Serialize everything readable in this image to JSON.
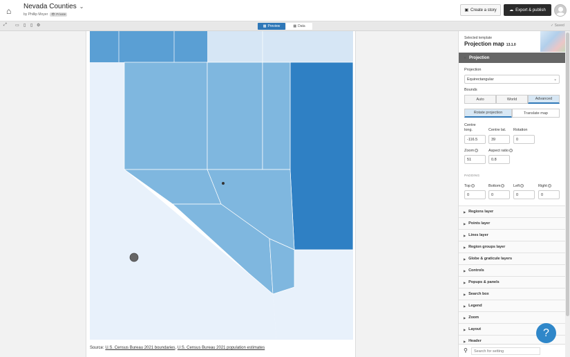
{
  "header": {
    "title": "Nevada Counties",
    "byline": "by Phillip Moyer",
    "visibility": "Private",
    "create_story": "Create a story",
    "export_publish": "Export & publish"
  },
  "toolbar": {
    "preview": "Preview",
    "data": "Data",
    "saved": "Saved"
  },
  "map": {
    "source_prefix": "Source: ",
    "source_link1": "U.S. Census Bureau 2021 boundaries",
    "source_sep": ", ",
    "source_link2": "U.S. Census Bureau 2021 population estimates",
    "colors": {
      "light": "#e8f1fb",
      "mid": "#7fb7df",
      "mid2": "#5a9fd4",
      "dark": "#2f80c4",
      "pale": "#d6e6f5"
    }
  },
  "sidebar": {
    "selected_template": "Selected template",
    "template_name": "Projection map",
    "template_version": "13.1.0",
    "section": "Projection",
    "projection_label": "Projection",
    "projection_value": "Equirectangular",
    "bounds_label": "Bounds",
    "bounds_options": [
      "Auto",
      "World",
      "Advanced"
    ],
    "mode_options": [
      "Rotate projection",
      "Translate map"
    ],
    "centre_long_label": "Centre long.",
    "centre_long": "-116.5",
    "centre_lat_label": "Centre lat.",
    "centre_lat": "39",
    "rotation_label": "Rotation",
    "rotation": "0",
    "zoom_label": "Zoom",
    "zoom": "51",
    "aspect_label": "Aspect ratio",
    "aspect": "0.8",
    "padding_label": "PADDING",
    "pad_top_label": "Top",
    "pad_top": "0",
    "pad_bottom_label": "Bottom",
    "pad_bottom": "0",
    "pad_left_label": "Left",
    "pad_left": "0",
    "pad_right_label": "Right",
    "pad_right": "0",
    "layers": [
      "Regions layer",
      "Points layer",
      "Lines layer",
      "Region groups layer",
      "Globe & graticule layers",
      "Controls",
      "Popups & panels",
      "Search box",
      "Legend",
      "Zoom",
      "Layout",
      "Header"
    ],
    "search_placeholder": "Search for setting"
  },
  "help": "?"
}
